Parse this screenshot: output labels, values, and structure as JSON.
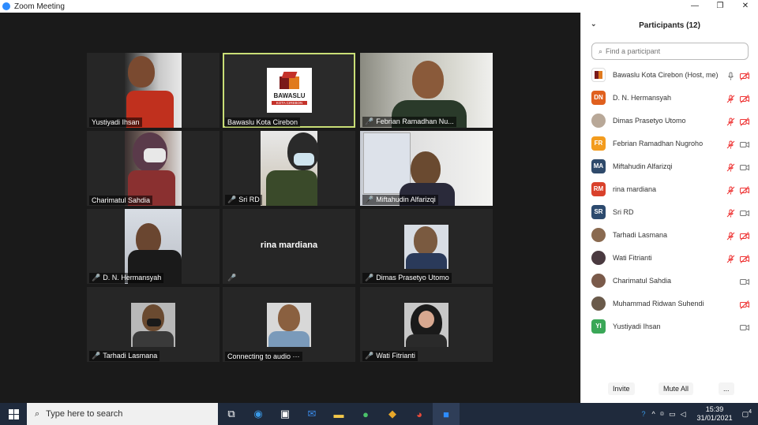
{
  "window": {
    "title": "Zoom Meeting",
    "controls": [
      "—",
      "❐",
      "✕"
    ]
  },
  "tiles": [
    {
      "name": "Yustiyadi Ihsan",
      "muted": false
    },
    {
      "name": "Bawaslu Kota Cirebon",
      "muted": false,
      "logo_main": "BAWASLU",
      "logo_sub": "KOTA CIREBON"
    },
    {
      "name": "Febrian Ramadhan Nu...",
      "muted": true
    },
    {
      "name": "Charimatul Sahdia",
      "muted": false
    },
    {
      "name": "Sri RD",
      "muted": true
    },
    {
      "name": "Miftahudin Alfarizqi",
      "muted": true
    },
    {
      "name": "D. N. Hermansyah",
      "muted": true
    },
    {
      "name": "",
      "muted": true,
      "center_name": "rina mardiana"
    },
    {
      "name": "Dimas Prasetyo Utomo",
      "muted": true
    },
    {
      "name": "Tarhadi Lasmana",
      "muted": true
    },
    {
      "name": "Connecting to audio ···",
      "muted": false
    },
    {
      "name": "Wati Fitrianti",
      "muted": true
    }
  ],
  "participants_panel": {
    "title": "Participants (12)",
    "search_placeholder": "Find a participant",
    "participants": [
      {
        "name": "Bawaslu Kota Cirebon (Host, me)",
        "initials": "",
        "color": "#ffffff",
        "mic": "on",
        "cam": "off"
      },
      {
        "name": "D. N. Hermansyah",
        "initials": "DN",
        "color": "#e0601e",
        "mic": "off",
        "cam": "off"
      },
      {
        "name": "Dimas Prasetyo Utomo",
        "initials": "",
        "color": "#b8a898",
        "mic": "off",
        "cam": "off"
      },
      {
        "name": "Febrian Ramadhan Nugroho",
        "initials": "FR",
        "color": "#f39c1e",
        "mic": "off",
        "cam": "on"
      },
      {
        "name": "Miftahudin Alfarizqi",
        "initials": "MA",
        "color": "#2f4a6b",
        "mic": "off",
        "cam": "on"
      },
      {
        "name": "rina mardiana",
        "initials": "RM",
        "color": "#d9412b",
        "mic": "off",
        "cam": "off"
      },
      {
        "name": "Sri RD",
        "initials": "SR",
        "color": "#2c4a6e",
        "mic": "off",
        "cam": "on"
      },
      {
        "name": "Tarhadi Lasmana",
        "initials": "",
        "color": "#8a6a50",
        "mic": "off",
        "cam": "off"
      },
      {
        "name": "Wati Fitrianti",
        "initials": "",
        "color": "#4a3a40",
        "mic": "off",
        "cam": "off"
      },
      {
        "name": "Charimatul Sahdia",
        "initials": "",
        "color": "#7a5a4a",
        "mic": "none",
        "cam": "on"
      },
      {
        "name": "Muhammad Ridwan Suhendi",
        "initials": "",
        "color": "#6a5a4a",
        "mic": "none",
        "cam": "off"
      },
      {
        "name": "Yustiyadi Ihsan",
        "initials": "YI",
        "color": "#3aa757",
        "mic": "none",
        "cam": "on"
      }
    ],
    "invite_label": "Invite",
    "mute_all_label": "Mute All",
    "more_label": "..."
  },
  "taskbar": {
    "search_placeholder": "Type here to search",
    "time": "15:39",
    "date": "31/01/2021",
    "notification_count": "4"
  }
}
